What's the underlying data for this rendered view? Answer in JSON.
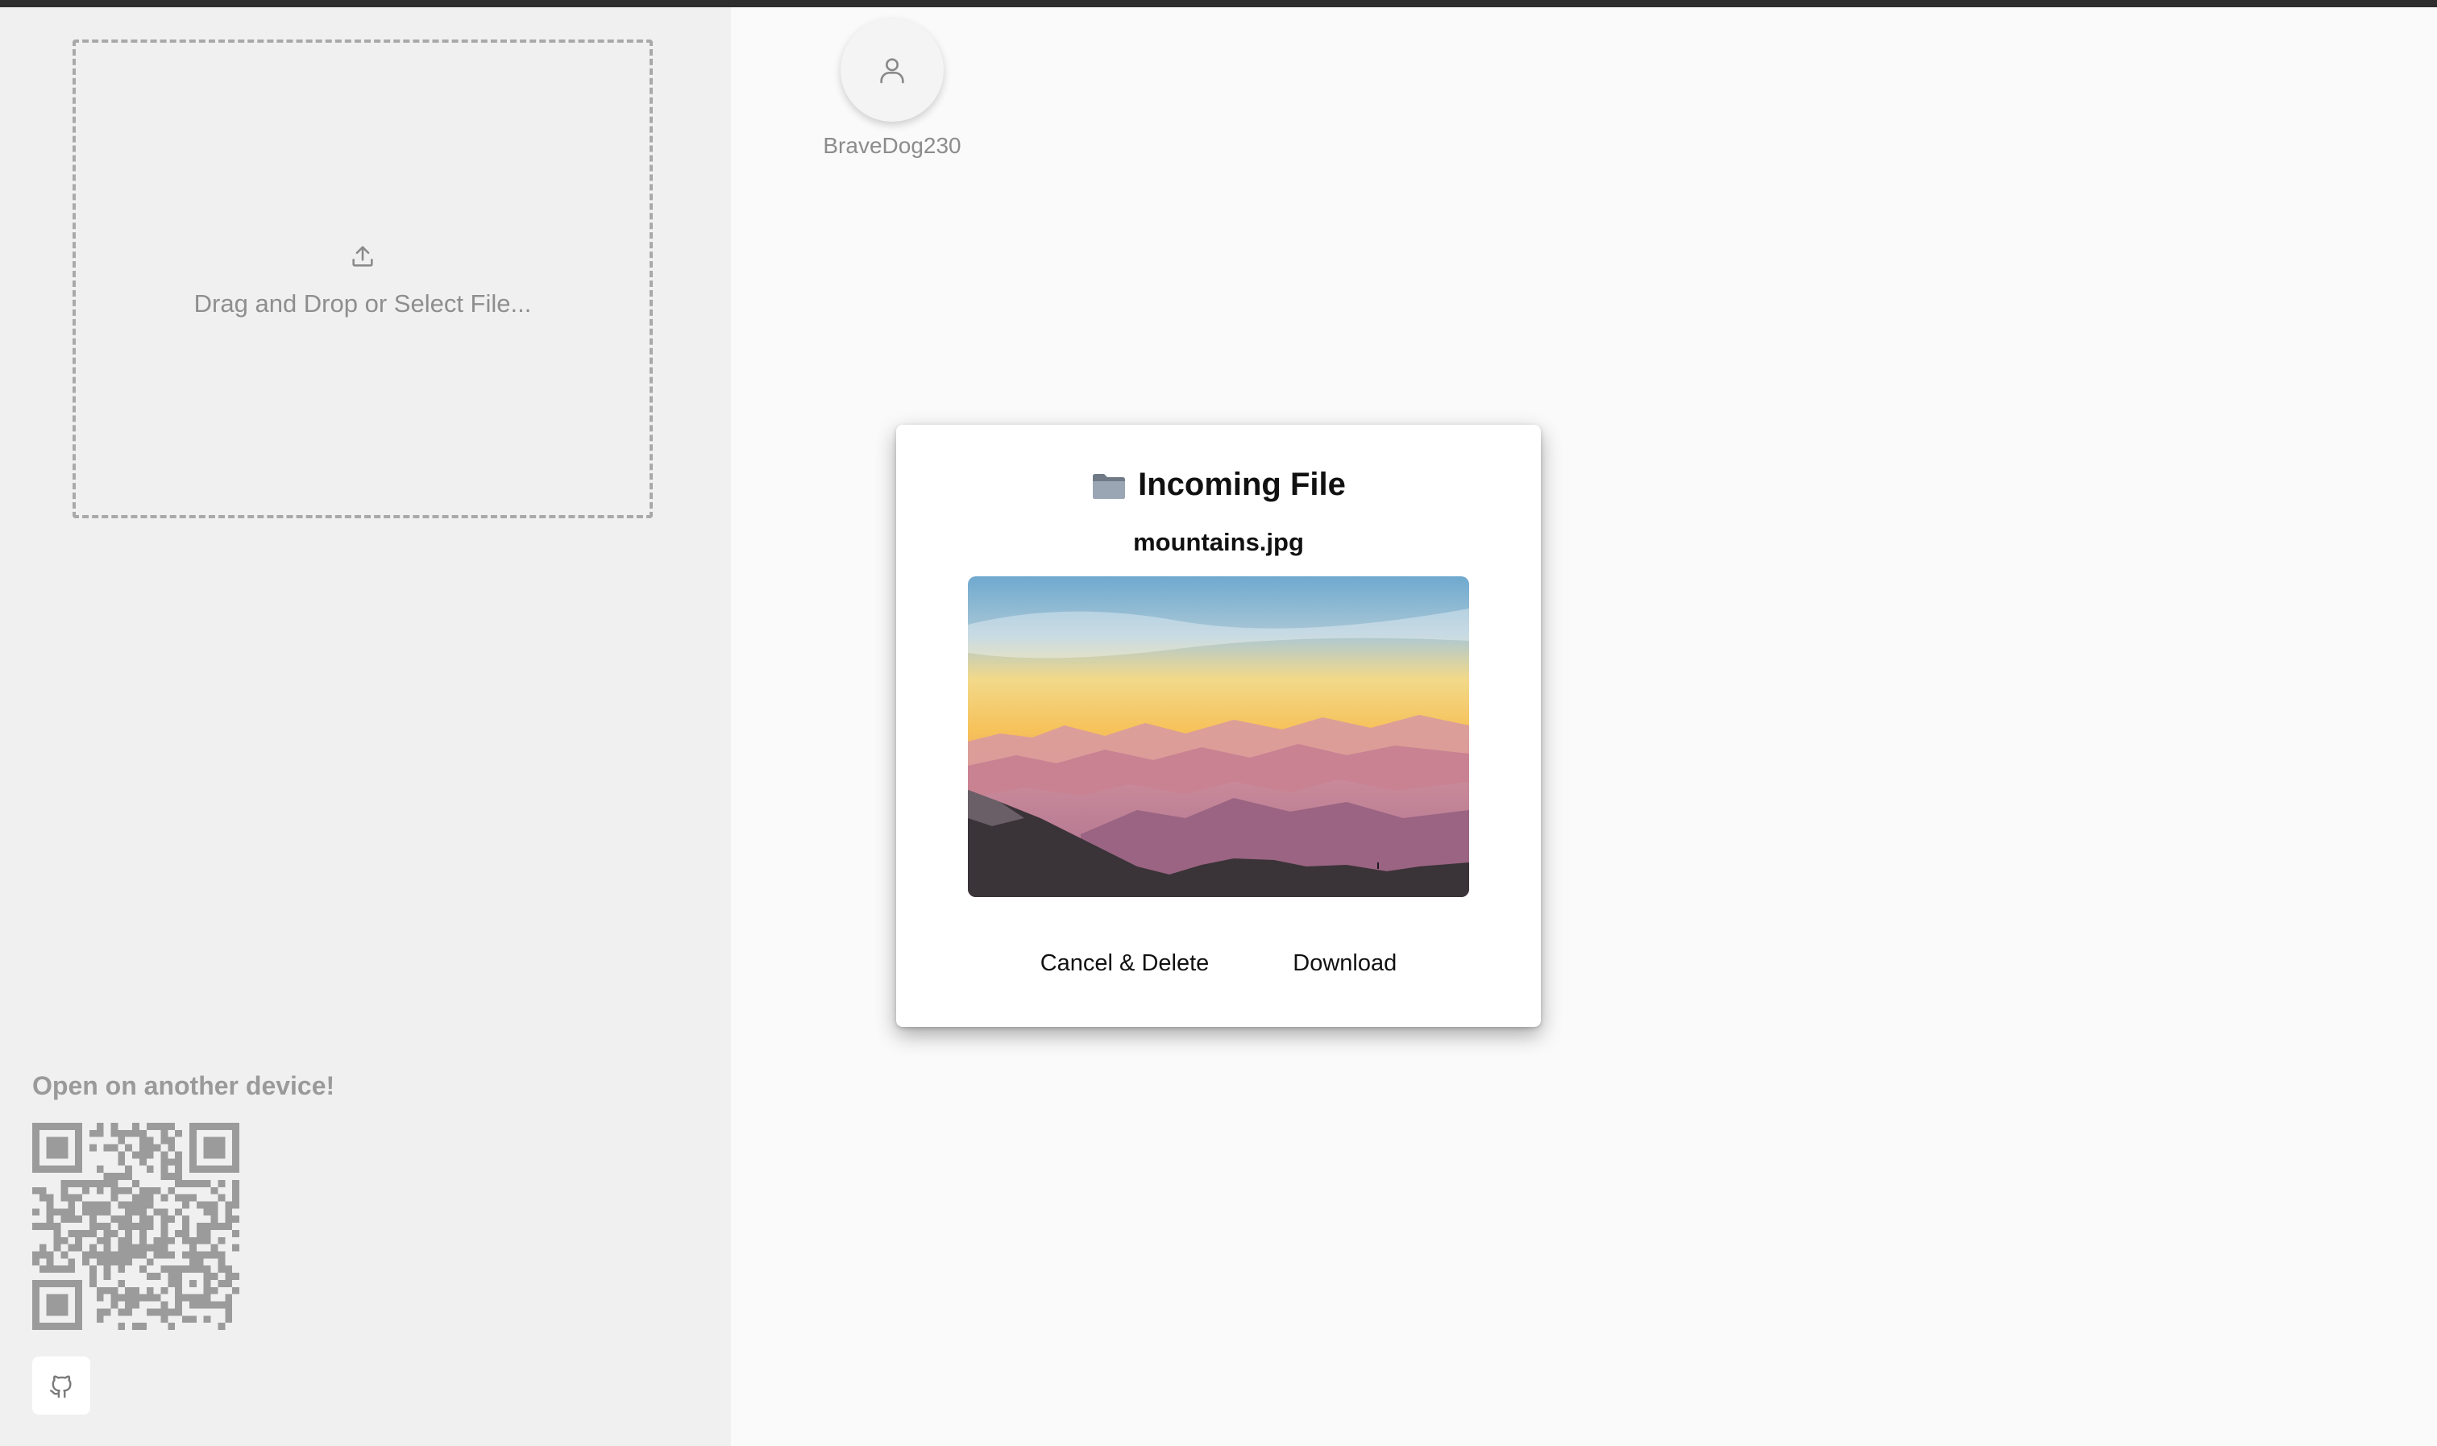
{
  "dropzone": {
    "icon": "upload-icon",
    "text": "Drag and Drop or Select File..."
  },
  "share": {
    "heading": "Open on another device!",
    "qr_icon": "qr-code",
    "github_icon": "github-icon"
  },
  "peers": [
    {
      "name": "BraveDog230",
      "icon": "user-icon"
    }
  ],
  "dialog": {
    "title": "Incoming File",
    "title_icon": "folder-icon",
    "file_name": "mountains.jpg",
    "cancel_label": "Cancel & Delete",
    "download_label": "Download"
  },
  "colors": {
    "sidebar_bg": "#f0f0f0",
    "main_bg": "#fafafa",
    "muted_text": "#8e8e8e"
  }
}
